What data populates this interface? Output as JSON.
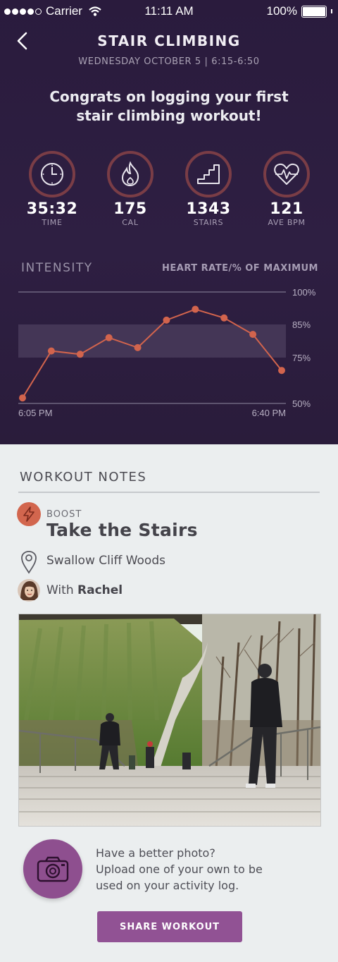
{
  "status_bar": {
    "carrier": "Carrier",
    "time": "11:11 AM",
    "battery": "100%"
  },
  "header": {
    "title": "STAIR CLIMBING",
    "subtitle": "WEDNESDAY OCTOBER 5 | 6:15-6:50",
    "congrats": "Congrats on logging your first stair climbing workout!"
  },
  "stats": [
    {
      "icon": "clock-icon",
      "value": "35:32",
      "label": "TIME"
    },
    {
      "icon": "flame-icon",
      "value": "175",
      "label": "CAL"
    },
    {
      "icon": "stairs-icon",
      "value": "1343",
      "label": "STAIRS"
    },
    {
      "icon": "heartbeat-icon",
      "value": "121",
      "label": "AVE BPM"
    }
  ],
  "chart_data": {
    "type": "line",
    "title": "INTENSITY",
    "ylabel": "HEART RATE/% OF MAXIMUM",
    "x_labels": [
      "6:05 PM",
      "6:40 PM"
    ],
    "y_ticks": [
      "100%",
      "85%",
      "75%",
      "50%"
    ],
    "series": [
      {
        "values": [
          53,
          77,
          76,
          81,
          78,
          87,
          92,
          88,
          82,
          68
        ]
      }
    ],
    "zone": [
      75,
      85
    ],
    "line_color": "#d2644d",
    "zone_color": "#443656"
  },
  "notes": {
    "title": "WORKOUT NOTES",
    "boost_tag": "BOOST",
    "boost_name": "Take the Stairs",
    "location": "Swallow Cliff Woods",
    "with_prefix": "With",
    "with_name": "Rachel"
  },
  "upload": {
    "line1": "Have a better photo?",
    "line2": "Upload one of your own to be",
    "line3": "used on your activity log."
  },
  "share_label": "SHARE WORKOUT"
}
